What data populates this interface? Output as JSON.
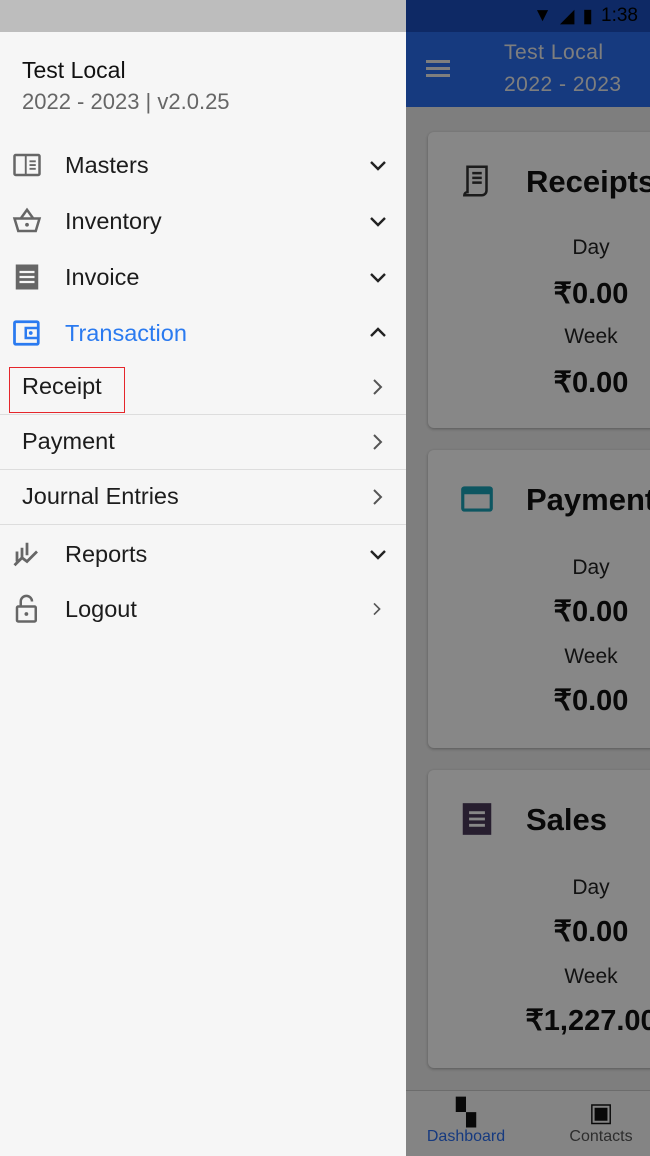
{
  "status_bar": {
    "time": "1:38"
  },
  "app_bar": {
    "title": "Test Local",
    "subtitle": "2022 - 2023"
  },
  "cards": [
    {
      "title": "Receipts",
      "icon": "receipt-icon",
      "day_label": "Day",
      "day_value": "₹0.00",
      "week_label": "Week",
      "week_value": "₹0.00"
    },
    {
      "title": "Payment",
      "icon": "credit-card-icon",
      "day_label": "Day",
      "day_value": "₹0.00",
      "week_label": "Week",
      "week_value": "₹0.00"
    },
    {
      "title": "Sales",
      "icon": "invoice-icon",
      "day_label": "Day",
      "day_value": "₹0.00",
      "week_label": "Week",
      "week_value": "₹1,227.00"
    }
  ],
  "bottom_nav": [
    {
      "label": "Dashboard",
      "active": true
    },
    {
      "label": "Contacts",
      "active": false
    }
  ],
  "drawer": {
    "company": "Test Local",
    "version": "2022 - 2023 | v2.0.25",
    "items": [
      {
        "label": "Masters",
        "icon": "book-icon"
      },
      {
        "label": "Inventory",
        "icon": "basket-icon"
      },
      {
        "label": "Invoice",
        "icon": "invoice-icon"
      },
      {
        "label": "Transaction",
        "icon": "wallet-icon",
        "expanded": true
      },
      {
        "label": "Reports",
        "icon": "chart-icon"
      },
      {
        "label": "Logout",
        "icon": "lock-icon"
      }
    ],
    "subitems": [
      {
        "label": "Receipt",
        "highlighted": true
      },
      {
        "label": "Payment"
      },
      {
        "label": "Journal Entries"
      }
    ]
  },
  "colors": {
    "accent": "#2a7af0",
    "highlight": "#e5262b"
  }
}
